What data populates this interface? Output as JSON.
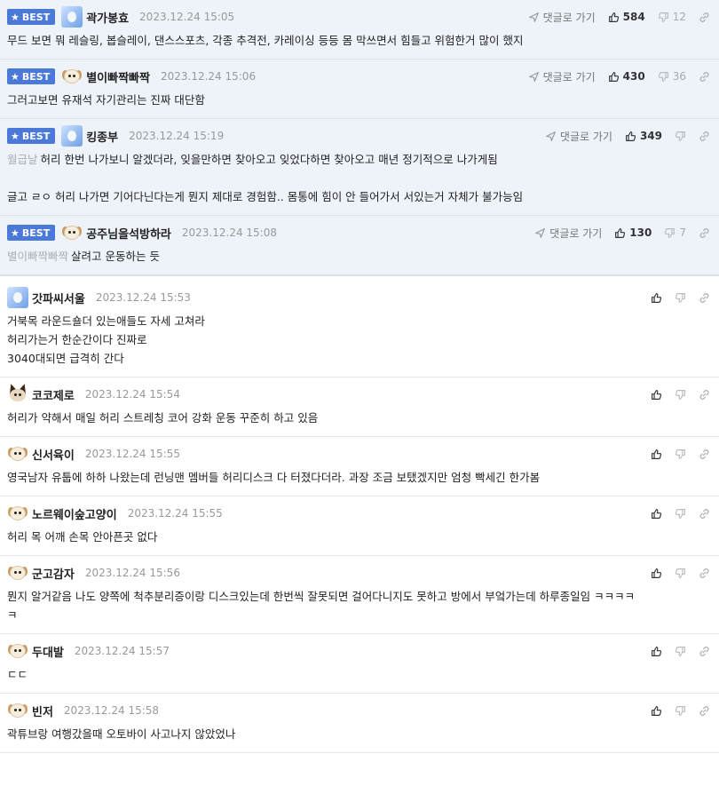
{
  "best_label": "BEST",
  "goto_label": "댓글로 가기",
  "best_comments": [
    {
      "nick": "곽가봉효",
      "date": "2023.12.24 15:05",
      "up": "584",
      "down": "12",
      "avatar": "blue",
      "lines": [
        "무드 보면 뭐 레슬링, 봅슬레이, 댄스스포츠, 각종 추격전, 카레이싱 등등 몸 막쓰면서 힘들고 위험한거 많이 했지"
      ]
    },
    {
      "nick": "별이빠짝빠짝",
      "date": "2023.12.24 15:06",
      "up": "430",
      "down": "36",
      "avatar": "dog",
      "lines": [
        "그러고보면 유재석 자기관리는 진짜 대단함"
      ]
    },
    {
      "nick": "킹종부",
      "date": "2023.12.24 15:19",
      "up": "349",
      "down": "",
      "avatar": "blue",
      "reply_to": "월급날",
      "lines": [
        "허리 한번 나가보니 알겠더라, 잊을만하면 찾아오고 잊었다하면 찾아오고 매년 정기적으로 나가게됨",
        "",
        "글고 ㄹㅇ 허리 나가면 기어다닌다는게 뭔지 제대로 경험함.. 몸통에 힘이 안 들어가서 서있는거 자체가 불가능임"
      ]
    },
    {
      "nick": "공주님을석방하라",
      "date": "2023.12.24 15:08",
      "up": "130",
      "down": "7",
      "avatar": "dog",
      "reply_to": "별이빠짝빠짝",
      "lines": [
        "살려고 운동하는 듯"
      ]
    }
  ],
  "comments": [
    {
      "nick": "갓파씨서울",
      "date": "2023.12.24 15:53",
      "avatar": "blue",
      "lines": [
        "거북목 라운드숄더 있는애들도 자세 고쳐라",
        "허리가는거 한순간이다 진짜로",
        "3040대되면 급격히 간다"
      ]
    },
    {
      "nick": "코코제로",
      "date": "2023.12.24 15:54",
      "avatar": "fox",
      "lines": [
        "허리가 약해서 매일 허리 스트레칭 코어 강화 운동 꾸준히 하고 있음"
      ]
    },
    {
      "nick": "신서육이",
      "date": "2023.12.24 15:55",
      "avatar": "dog",
      "lines": [
        "영국남자 유툽에 하하 나왔는데 런닝맨 멤버들 허리디스크 다 터졌다더라. 과장 조금 보탰겠지만 엄청 빡세긴 한가봄"
      ]
    },
    {
      "nick": "노르웨이숲고양이",
      "date": "2023.12.24 15:55",
      "avatar": "dog",
      "lines": [
        "허리 목 어깨 손목 안아픈곳 없다"
      ]
    },
    {
      "nick": "군고감자",
      "date": "2023.12.24 15:56",
      "avatar": "dog",
      "lines": [
        "뭔지 알거같음 나도 양쪽에 척추분리증이랑 디스크있는데 한번씩 잘못되면 걸어다니지도 못하고 방에서 부엌가는데 하루종일임 ㅋㅋㅋㅋ",
        "ㅋ"
      ]
    },
    {
      "nick": "두대발",
      "date": "2023.12.24 15:57",
      "avatar": "dog",
      "lines": [
        "ㄷㄷ"
      ]
    },
    {
      "nick": "빈저",
      "date": "2023.12.24 15:58",
      "avatar": "dog",
      "lines": [
        "곽튜브랑 여행갔을때 오토바이 사고나지 않았었나"
      ]
    }
  ],
  "icons": {
    "goto": "arrow-icon",
    "up": "thumbs-up-icon",
    "down": "thumbs-down-icon",
    "link": "link-icon",
    "star": "star-icon"
  },
  "colors": {
    "best_badge": "#4a79d8",
    "best_bg": "#eef2f9",
    "reply_to": "#a9aeb8"
  }
}
